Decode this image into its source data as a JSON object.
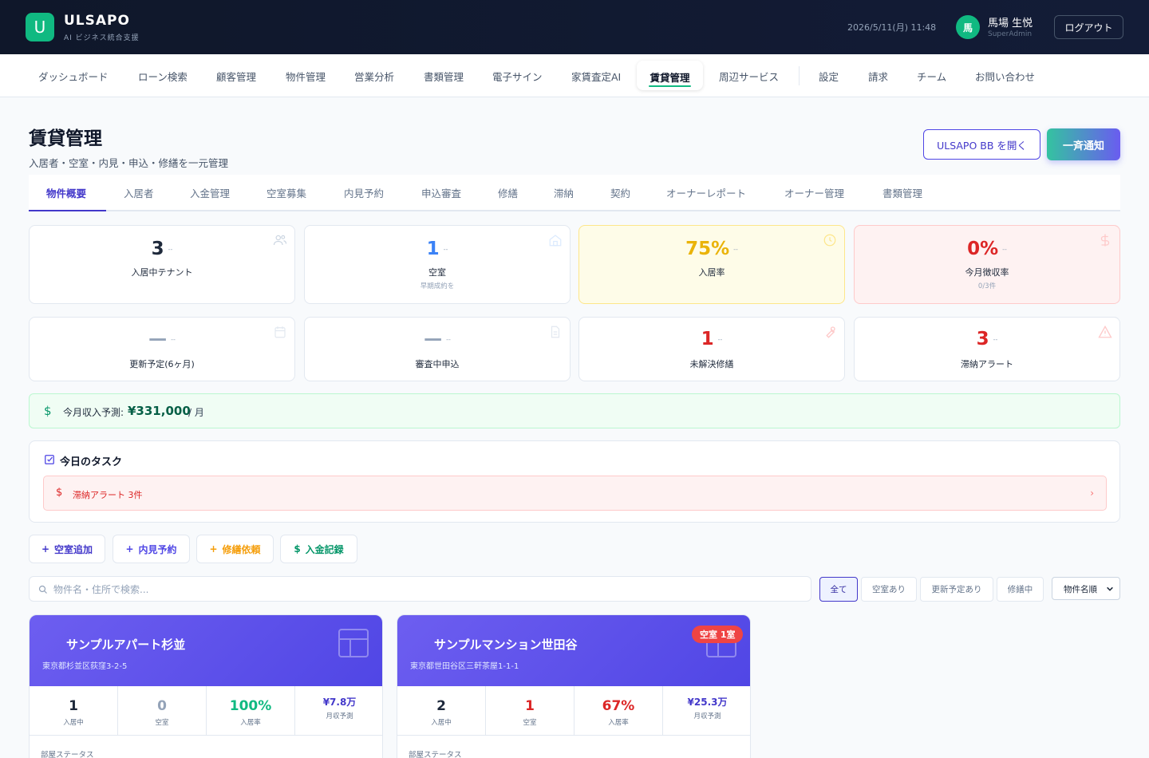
{
  "header": {
    "logo_letter": "U",
    "brand": "ULSAPO",
    "tagline": "AI ビジネス統合支援",
    "datetime": "2026/5/11(月) 11:48",
    "avatar_initial": "馬",
    "user_name": "馬場 生悦",
    "user_role": "SuperAdmin",
    "logout": "ログアウト"
  },
  "nav": {
    "items": [
      "ダッシュボード",
      "ローン検索",
      "顧客管理",
      "物件管理",
      "営業分析",
      "書類管理",
      "電子サイン",
      "家賃査定AI",
      "賃貸管理",
      "周辺サービス",
      "設定",
      "請求",
      "チーム",
      "お問い合わせ"
    ],
    "active": "賃貸管理"
  },
  "page": {
    "title": "賃貸管理",
    "subtitle": "入居者・空室・内見・申込・修繕を一元管理",
    "bb_button": "ULSAPO BB を開く",
    "notify_button": "一斉通知"
  },
  "subtabs": [
    "物件概要",
    "入居者",
    "入金管理",
    "空室募集",
    "内見予約",
    "申込審査",
    "修繕",
    "滞納",
    "契約",
    "オーナーレポート",
    "オーナー管理",
    "書類管理"
  ],
  "stats": [
    {
      "value": "3",
      "trend": "--",
      "label": "入居中テナント",
      "hint": "",
      "icon": "users-icon",
      "color": "#1e293b"
    },
    {
      "value": "1",
      "trend": "--",
      "label": "空室",
      "hint": "早期成約を",
      "icon": "home-icon",
      "color": "#3b82f6"
    },
    {
      "value": "75%",
      "trend": "--",
      "label": "入居率",
      "hint": "",
      "icon": "clock-icon",
      "color": "#eab308"
    },
    {
      "value": "0%",
      "trend": "--",
      "label": "今月徴収率",
      "hint": "0/3件",
      "icon": "dollar-icon",
      "color": "#dc2626"
    },
    {
      "value": "—",
      "trend": "--",
      "label": "更新予定(6ヶ月)",
      "hint": "",
      "icon": "calendar-icon",
      "color": "#94a3b8"
    },
    {
      "value": "—",
      "trend": "--",
      "label": "審査中申込",
      "hint": "",
      "icon": "document-icon",
      "color": "#94a3b8"
    },
    {
      "value": "1",
      "trend": "--",
      "label": "未解決修繕",
      "hint": "",
      "icon": "wrench-icon",
      "color": "#dc2626"
    },
    {
      "value": "3",
      "trend": "--",
      "label": "滞納アラート",
      "hint": "",
      "icon": "warning-icon",
      "color": "#dc2626"
    }
  ],
  "income": {
    "icon": "$",
    "label": "今月収入予測:",
    "value": "¥331,000",
    "unit": "/ 月"
  },
  "tasks": {
    "title": "今日のタスク",
    "alert_icon": "$",
    "alert_text": "滞納アラート 3件",
    "chevron": "›"
  },
  "quick_actions": [
    {
      "icon": "+",
      "label": "空室追加",
      "color": "#4338ca"
    },
    {
      "icon": "+",
      "label": "内見予約",
      "color": "#4f46e5"
    },
    {
      "icon": "+",
      "label": "修繕依頼",
      "color": "#f59e0b"
    },
    {
      "icon": "$",
      "label": "入金記録",
      "color": "#059669"
    }
  ],
  "search": {
    "placeholder": "物件名・住所で検索..."
  },
  "filters": [
    "全て",
    "空室あり",
    "更新予定あり",
    "修繕中"
  ],
  "sort": {
    "selected": "物件名順"
  },
  "properties": [
    {
      "name": "サンプルアパート杉並",
      "address": "東京都杉並区荻窪3-2-5",
      "badge": "",
      "occupied": "1",
      "occupied_label": "入居中",
      "vacant": "0",
      "vacant_label": "空室",
      "rate": "100%",
      "rate_label": "入居率",
      "income": "¥7.8万",
      "income_label": "月収予測",
      "room_status": "部屋ステータス",
      "vacant_color": "#94a3b8",
      "rate_color": "#10b981"
    },
    {
      "name": "サンプルマンション世田谷",
      "address": "東京都世田谷区三軒茶屋1-1-1",
      "badge": "空室 1室",
      "occupied": "2",
      "occupied_label": "入居中",
      "vacant": "1",
      "vacant_label": "空室",
      "rate": "67%",
      "rate_label": "入居率",
      "income": "¥25.3万",
      "income_label": "月収予測",
      "room_status": "部屋ステータス",
      "vacant_color": "#dc2626",
      "rate_color": "#dc2626"
    }
  ]
}
